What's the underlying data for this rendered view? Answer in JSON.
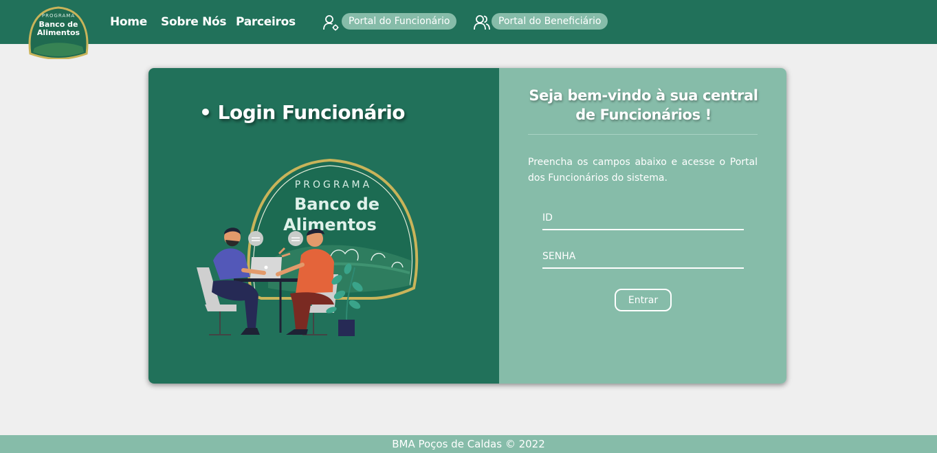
{
  "nav": {
    "logo_alt": "Banco de Alimentos logo",
    "logo_text_small": "PROGRAMA",
    "logo_text_line1": "Banco de",
    "logo_text_line2": "Alimentos",
    "links": [
      {
        "label": "Home"
      },
      {
        "label": "Sobre Nós"
      },
      {
        "label": "Parceiros"
      }
    ],
    "portal_funcionario": {
      "label": "Portal do Funcionário",
      "icon": "user-gear-icon"
    },
    "portal_beneficiario": {
      "label": "Portal do Beneficiário",
      "icon": "users-icon"
    }
  },
  "login_panel": {
    "title": "• Login Funcionário",
    "illustration": {
      "badge_small": "PROGRAMA",
      "badge_line1": "Banco de",
      "badge_line2": "Alimentos"
    }
  },
  "form_panel": {
    "welcome": "Seja bem-vindo à sua central de Funcionários !",
    "instructions": "Preencha os campos abaixo e acesse o Portal dos Funcionários do sistema.",
    "id_field": {
      "placeholder": "ID",
      "value": ""
    },
    "password_field": {
      "placeholder": "SENHA",
      "value": ""
    },
    "submit_label": "Entrar"
  },
  "footer": {
    "text": "BMA Poços de Caldas © 2022"
  },
  "colors": {
    "primary": "#21715a",
    "secondary": "#86bca9",
    "background": "#efefef",
    "gold": "#c9b45a"
  }
}
